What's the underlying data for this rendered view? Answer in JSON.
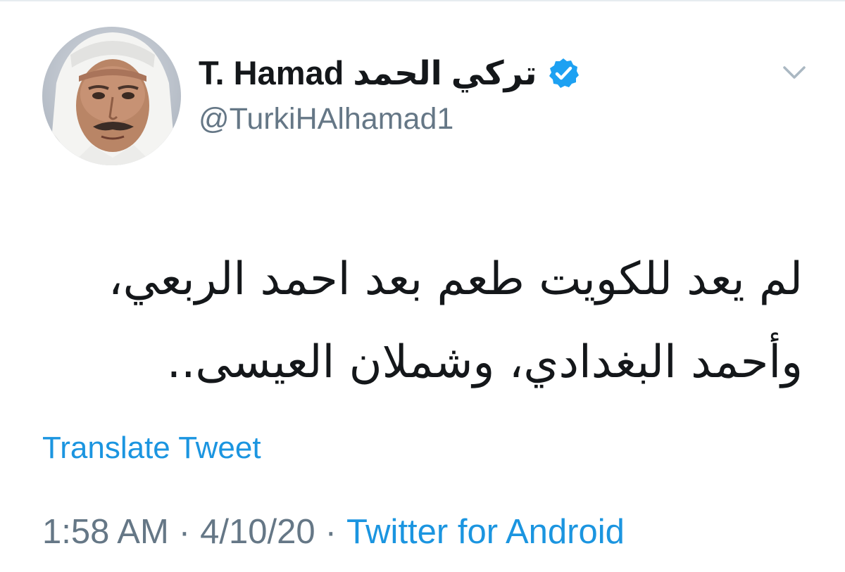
{
  "tweet": {
    "author": {
      "display_name": "T. Hamad تركي الحمد",
      "handle": "@TurkiHAlhamad1",
      "verified": true
    },
    "text_lines": [
      "لم يعد للكويت طعم بعد احمد الربعي،",
      "وأحمد البغدادي، وشملان العيسى.."
    ],
    "translate_label": "Translate Tweet",
    "time": "1:58 AM",
    "separator": "·",
    "date": "4/10/20",
    "source": "Twitter for Android"
  },
  "icons": {
    "verified": "verified-badge-icon",
    "caret": "chevron-down-icon",
    "avatar": "profile-photo"
  },
  "colors": {
    "link_blue": "#1b95e0",
    "text_dark": "#14171a",
    "text_gray": "#657786",
    "verified_blue": "#1da1f2"
  }
}
